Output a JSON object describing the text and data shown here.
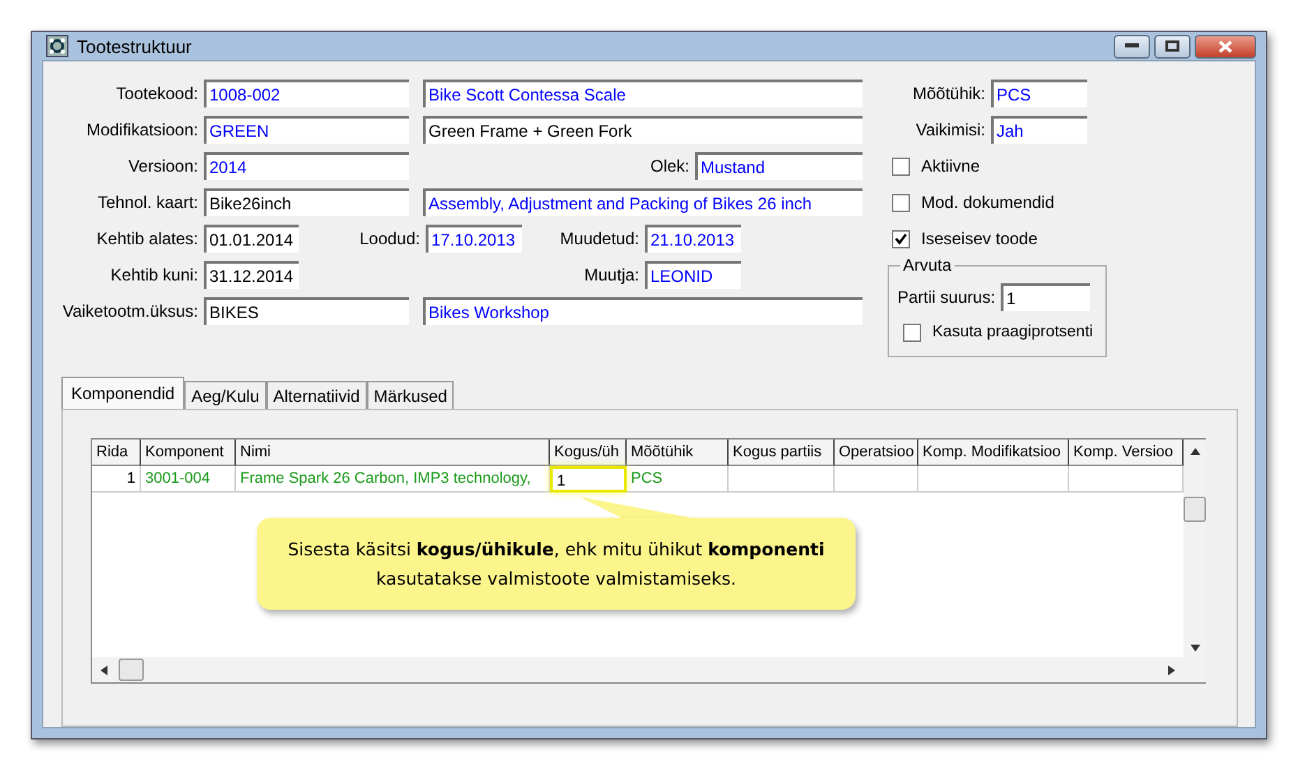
{
  "window": {
    "title": "Tootestruktuur"
  },
  "fields": [
    {
      "label": "Tootekood:",
      "value": "1008-002",
      "color": "#0000ff"
    },
    {
      "value": "Bike Scott Contessa Scale",
      "color": "#0000ff"
    },
    {
      "label": "Mõõtühik:",
      "value": "PCS",
      "color": "#0000ff"
    },
    {
      "label": "Modifikatsioon:",
      "value": "GREEN",
      "color": "#0000ff"
    },
    {
      "value": "Green Frame + Green Fork",
      "color": "#000000"
    },
    {
      "label": "Vaikimisi:",
      "value": "Jah",
      "color": "#0000ff"
    },
    {
      "label": "Versioon:",
      "value": "2014",
      "color": "#0000ff"
    },
    {
      "label": "Olek:",
      "value": "Mustand",
      "color": "#0000ff"
    },
    {
      "label": "Tehnol. kaart:",
      "value": "Bike26inch",
      "color": "#000000"
    },
    {
      "value": "Assembly, Adjustment and Packing of Bikes 26 inch",
      "color": "#0000ff"
    },
    {
      "label": "Kehtib alates:",
      "value": "01.01.2014",
      "color": "#000000"
    },
    {
      "label": "Loodud:",
      "value": "17.10.2013",
      "color": "#0000ff"
    },
    {
      "label": "Muudetud:",
      "value": "21.10.2013",
      "color": "#0000ff"
    },
    {
      "label": "Kehtib kuni:",
      "value": "31.12.2014",
      "color": "#000000"
    },
    {
      "label": "Muutja:",
      "value": "LEONID",
      "color": "#0000ff"
    },
    {
      "label": "Vaiketootm.üksus:",
      "value": "BIKES",
      "color": "#000000"
    },
    {
      "value": "Bikes Workshop",
      "color": "#0000ff"
    }
  ],
  "checkboxes": [
    {
      "label": "Aktiivne",
      "checked": false
    },
    {
      "label": "Mod. dokumendid",
      "checked": false
    },
    {
      "label": "Iseseisev toode",
      "checked": true
    }
  ],
  "arvuta": {
    "title": "Arvuta",
    "batch_label": "Partii suurus:",
    "batch_value": "1",
    "checkbox": {
      "label": "Kasuta praagiprotsenti",
      "checked": false
    }
  },
  "tabs": [
    {
      "label": "Komponendid",
      "selected": true
    },
    {
      "label": "Aeg/Kulu",
      "selected": false
    },
    {
      "label": "Alternatiivid",
      "selected": false
    },
    {
      "label": "Märkused",
      "selected": false
    }
  ],
  "table": {
    "columns": [
      "Rida",
      "Komponent",
      "Nimi",
      "Kogus/üh",
      "Mõõtühik",
      "Kogus partiis",
      "Operatsioo",
      "Komp. Modifikatsioo",
      "Komp. Versioo"
    ],
    "rows": [
      {
        "cells": [
          {
            "text": "1",
            "highlighted": false
          },
          {
            "text": "3001-004",
            "highlighted": false
          },
          {
            "text": "Frame Spark 26 Carbon, IMP3 technology,",
            "highlighted": false
          },
          {
            "text": "1",
            "highlighted": true
          },
          {
            "text": "PCS",
            "highlighted": false
          }
        ]
      }
    ]
  },
  "callout": {
    "text": "Sisesta käsitsi **kogus/ühikule**, ehk mitu ühikut **komponenti** kasutatakse valmistoote valmistamiseks."
  }
}
